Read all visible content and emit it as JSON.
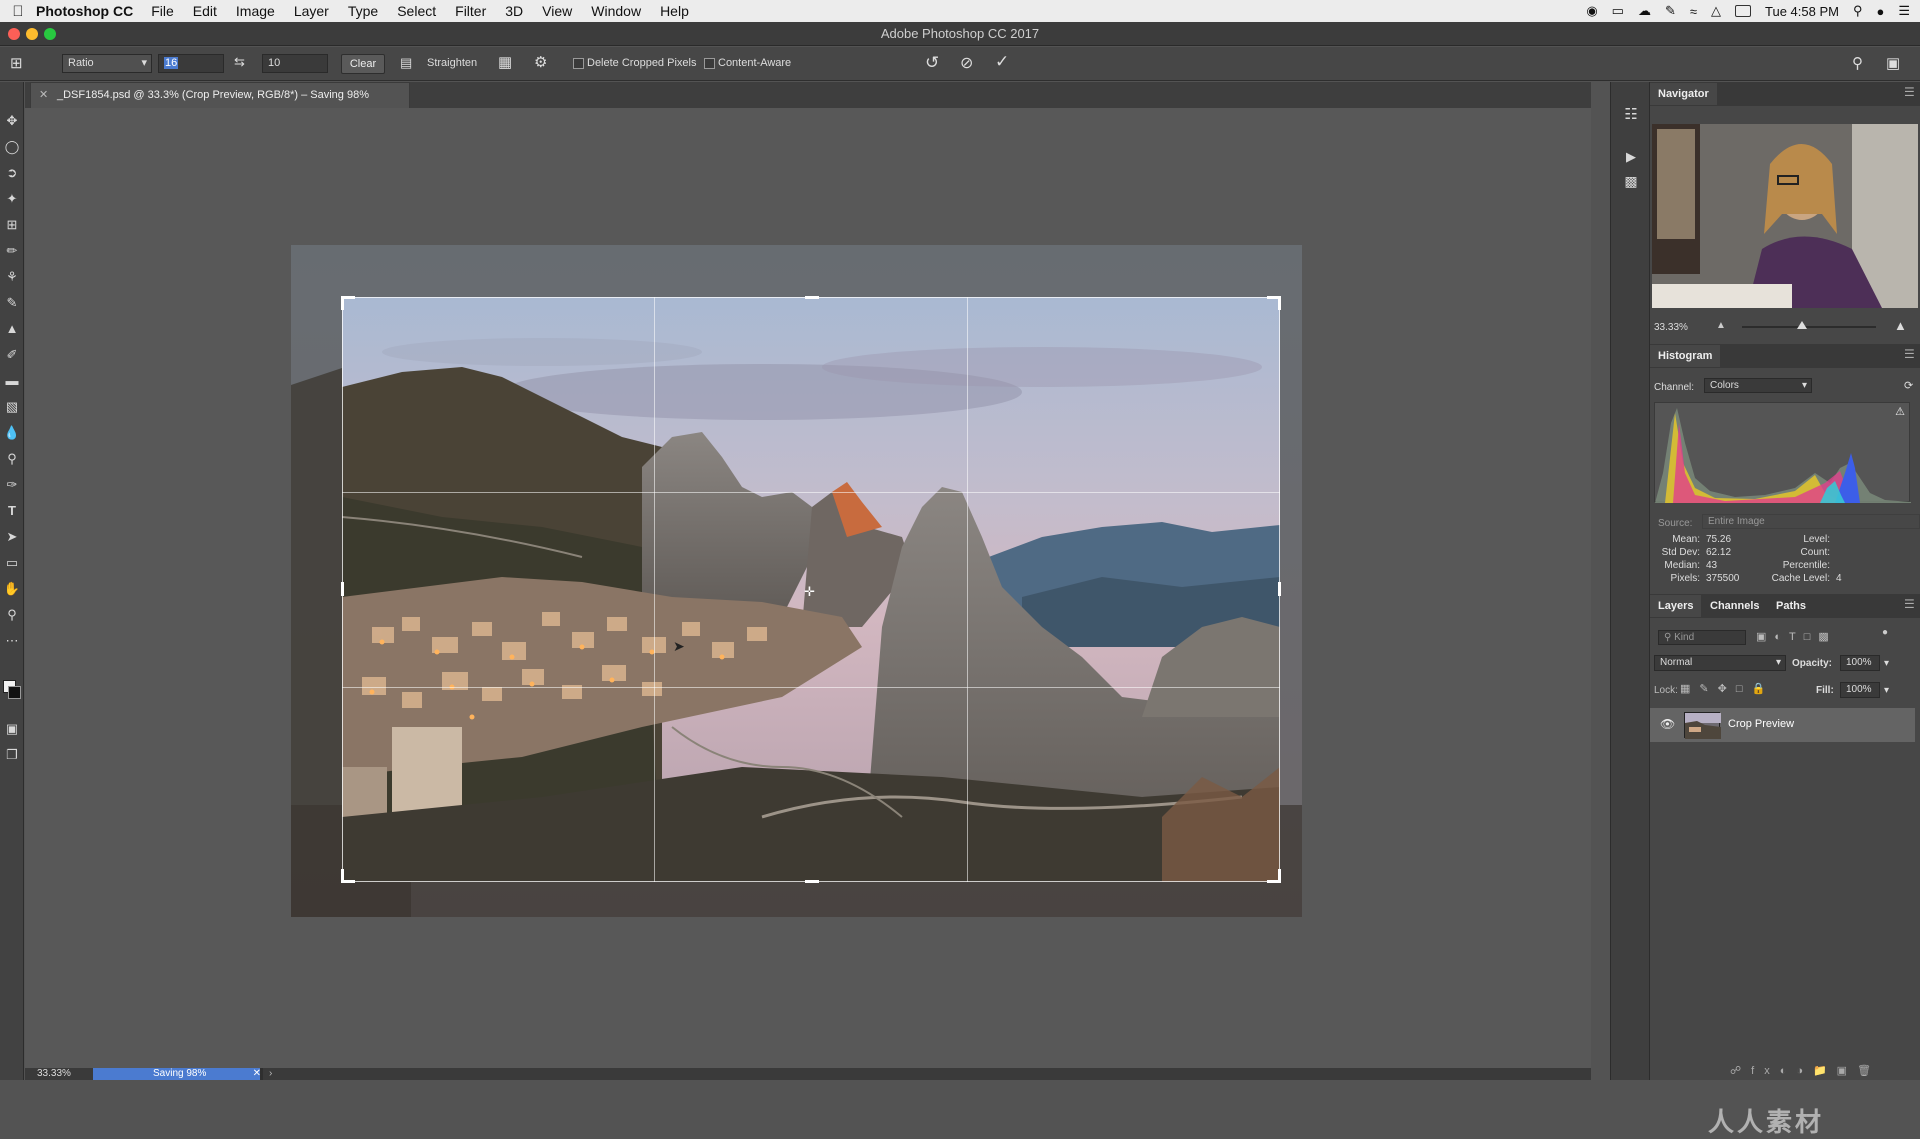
{
  "menubar": {
    "app_name": "Photoshop CC",
    "items": [
      "File",
      "Edit",
      "Image",
      "Layer",
      "Type",
      "Select",
      "Filter",
      "3D",
      "View",
      "Window",
      "Help"
    ],
    "clock": "Tue 4:58 PM"
  },
  "window": {
    "title": "Adobe Photoshop CC 2017"
  },
  "options": {
    "ratio_select": "Ratio",
    "width_value": "16",
    "height_value": "10",
    "clear_label": "Clear",
    "straighten_label": "Straighten",
    "delete_cropped_label": "Delete Cropped Pixels",
    "content_aware_label": "Content-Aware"
  },
  "document": {
    "tab_title": "_DSF1854.psd @ 33.3% (Crop Preview, RGB/8*) – Saving 98%"
  },
  "navigator": {
    "title": "Navigator",
    "zoom": "33.33%",
    "zoom_slider_fraction": 0.45
  },
  "histogram": {
    "title": "Histogram",
    "channel_label": "Channel:",
    "channel_value": "Colors",
    "source_label": "Source:",
    "source_value": "Entire Image",
    "stats": [
      {
        "label": "Mean:",
        "value": "75.26"
      },
      {
        "label": "Std Dev:",
        "value": "62.12"
      },
      {
        "label": "Median:",
        "value": "43"
      },
      {
        "label": "Pixels:",
        "value": "375500"
      }
    ],
    "stats_right": [
      {
        "label": "Level:",
        "value": ""
      },
      {
        "label": "Count:",
        "value": ""
      },
      {
        "label": "Percentile:",
        "value": ""
      },
      {
        "label": "Cache Level:",
        "value": "4"
      }
    ]
  },
  "layers": {
    "tabs": [
      "Layers",
      "Channels",
      "Paths"
    ],
    "filter_placeholder": "Kind",
    "blend_mode": "Normal",
    "opacity_label": "Opacity:",
    "opacity_value": "100%",
    "lock_label": "Lock:",
    "fill_label": "Fill:",
    "fill_value": "100%",
    "items": [
      {
        "name": "Crop Preview"
      }
    ]
  },
  "status": {
    "zoom": "33.33%",
    "progress_label": "Saving 98%",
    "progress_fraction": 0.98
  },
  "watermark": "人人素材",
  "colors": {
    "selection_blue": "#4b7bd0",
    "panel_bg": "#474747",
    "canvas_bg": "#585858"
  }
}
